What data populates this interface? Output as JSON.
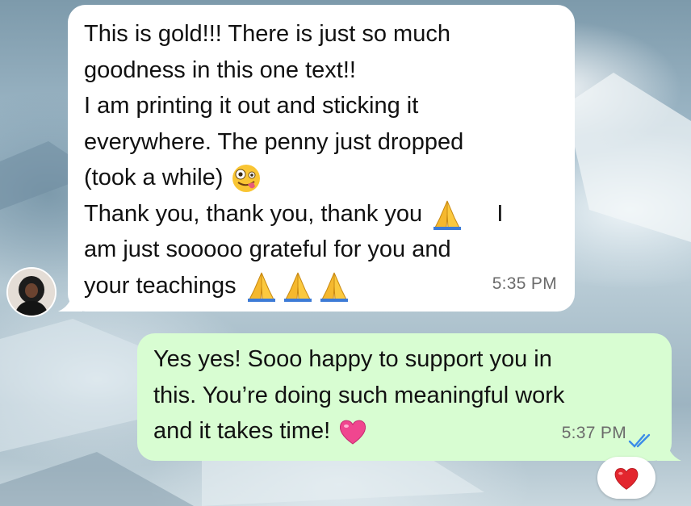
{
  "chat": {
    "incoming": {
      "lines": [
        "This is gold!!! There is just so much",
        "goodness in this one text!!",
        "I am printing it out and sticking it",
        "everywhere. The penny just dropped",
        "(took a while)",
        "Thank you, thank you, thank you",
        "I",
        "am just sooooo grateful for you and",
        "your teachings"
      ],
      "time": "5:35 PM",
      "emojis": [
        "zany-face-emoji",
        "folded-hands-emoji"
      ]
    },
    "outgoing": {
      "lines": [
        "Yes yes! Sooo happy to support you in",
        "this. You’re doing such meaningful work",
        "and it takes time!"
      ],
      "time": "5:37 PM",
      "status": "read",
      "emojis": [
        "pink-heart-emoji"
      ]
    },
    "reaction": "red-heart-emoji"
  },
  "colors": {
    "incoming_bubble": "#ffffff",
    "outgoing_bubble": "#d8fdd2",
    "read_ticks": "#3b8ce8",
    "timestamp": "#6b6b6b"
  }
}
